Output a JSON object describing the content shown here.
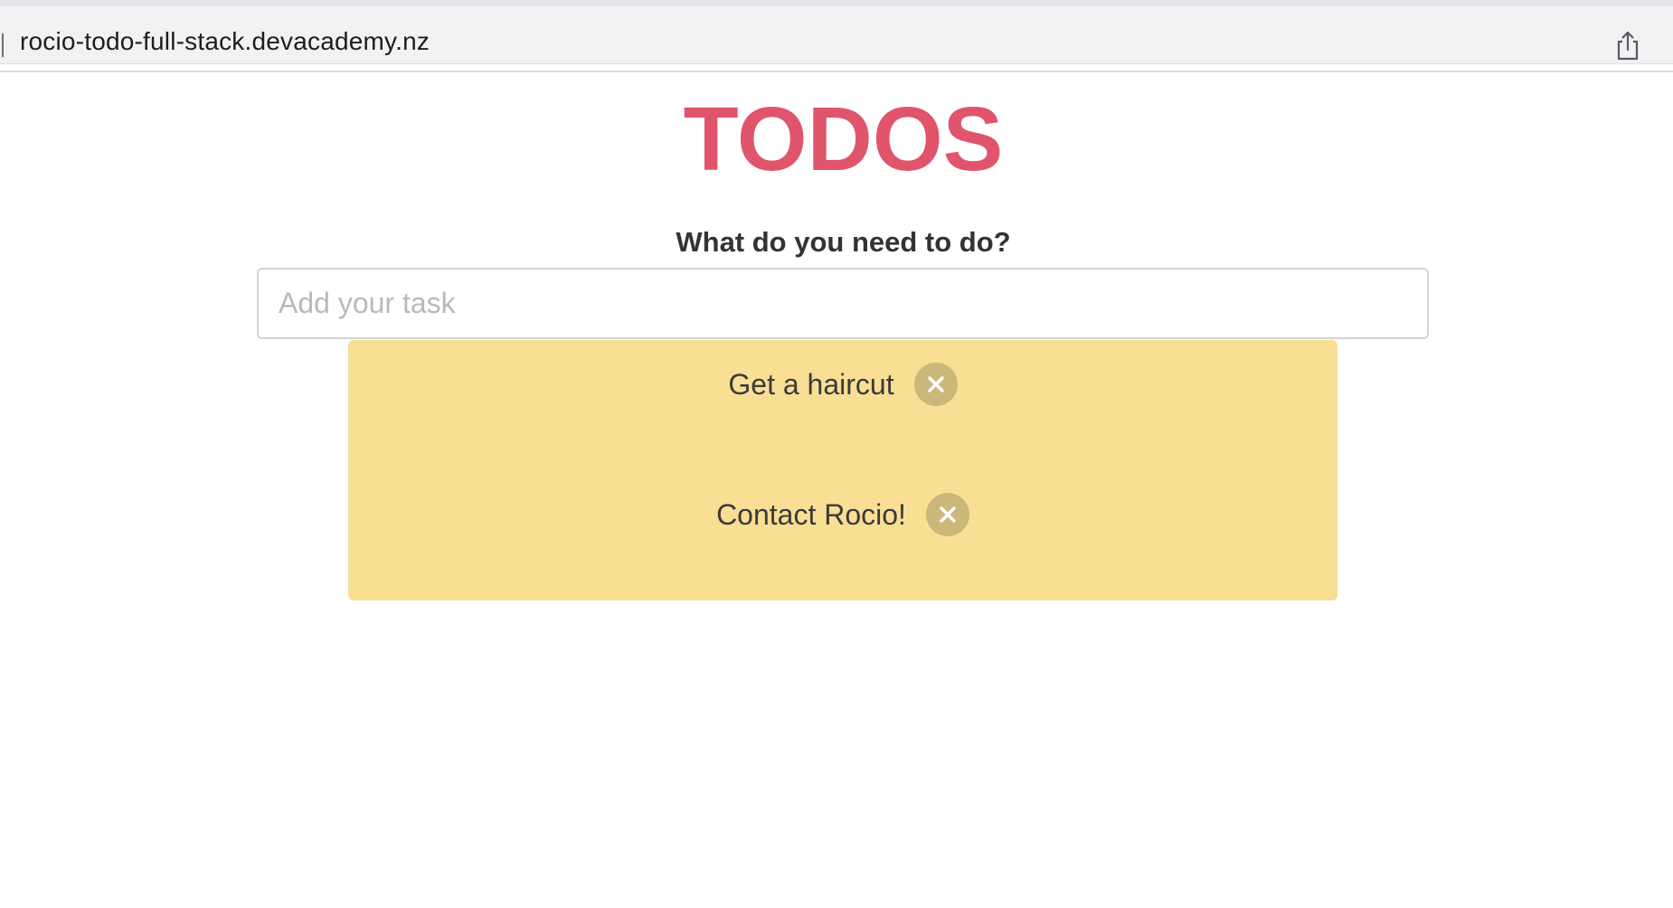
{
  "browser": {
    "url": "rocio-todo-full-stack.devacademy.nz",
    "share_icon": "share-icon"
  },
  "app": {
    "title": "TODOS",
    "prompt": "What do you need to do?",
    "input": {
      "placeholder": "Add your task",
      "value": ""
    },
    "todos": [
      {
        "text": "Get a haircut",
        "remove_icon": "close-icon"
      },
      {
        "text": "Contact Rocio!",
        "remove_icon": "close-icon"
      }
    ]
  },
  "colors": {
    "title": "#e0546c",
    "panel": "#f8df93",
    "remove_button": "#ccb77a"
  }
}
